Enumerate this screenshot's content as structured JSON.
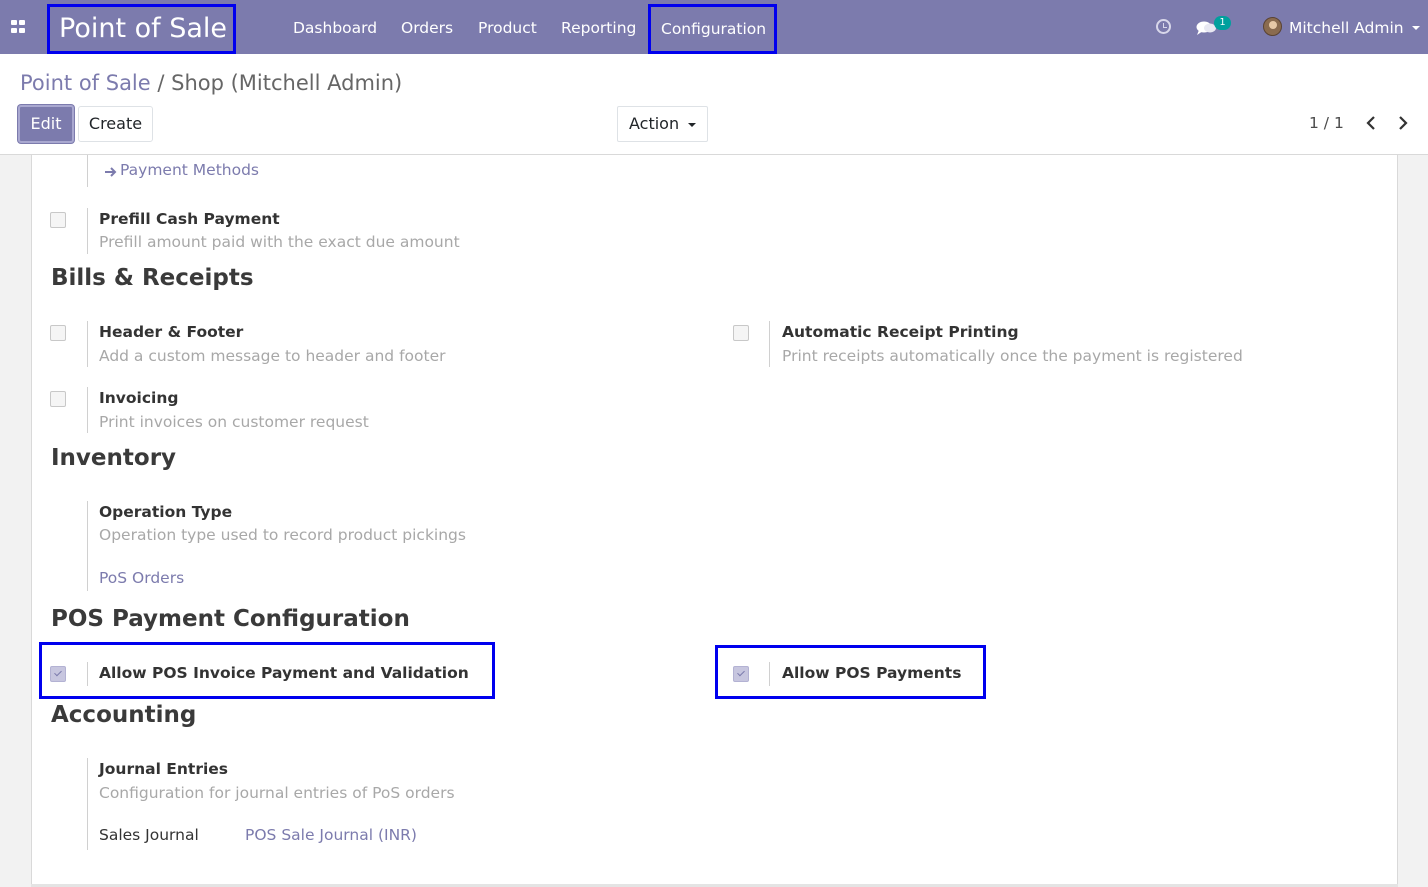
{
  "navbar": {
    "brand": "Point of Sale",
    "menu": [
      "Dashboard",
      "Orders",
      "Product",
      "Reporting"
    ],
    "config": "Configuration",
    "chat_badge": "1",
    "user": "Mitchell Admin"
  },
  "control_panel": {
    "breadcrumb_root": "Point of Sale",
    "breadcrumb_sep": " / ",
    "breadcrumb_current": "Shop (Mitchell Admin)",
    "edit_label": "Edit",
    "create_label": "Create",
    "action_label": "Action",
    "pager": "1 / 1"
  },
  "form": {
    "payment_methods_link": "Payment Methods",
    "prefill": {
      "label": "Prefill Cash Payment",
      "desc": "Prefill amount paid with the exact due amount",
      "checked": false
    },
    "bills_heading": "Bills & Receipts",
    "header_footer": {
      "label": "Header & Footer",
      "desc": "Add a custom message to header and footer",
      "checked": false
    },
    "auto_receipt": {
      "label": "Automatic Receipt Printing",
      "desc": "Print receipts automatically once the payment is registered",
      "checked": false
    },
    "invoicing": {
      "label": "Invoicing",
      "desc": "Print invoices on customer request",
      "checked": false
    },
    "inventory_heading": "Inventory",
    "operation_type": {
      "label": "Operation Type",
      "desc": "Operation type used to record product pickings",
      "value": "PoS Orders"
    },
    "pos_payment_heading": "POS Payment Configuration",
    "allow_invoice_payment": {
      "label": "Allow POS Invoice Payment and Validation",
      "checked": true
    },
    "allow_pos_payments": {
      "label": "Allow POS Payments",
      "checked": true
    },
    "accounting_heading": "Accounting",
    "journal_entries": {
      "label": "Journal Entries",
      "desc": "Configuration for journal entries of PoS orders",
      "field_label": "Sales Journal",
      "field_value": "POS Sale Journal (INR)"
    }
  },
  "colors": {
    "brand": "#7c7bad",
    "highlight": "#0000ee",
    "badge": "#00a09d"
  }
}
